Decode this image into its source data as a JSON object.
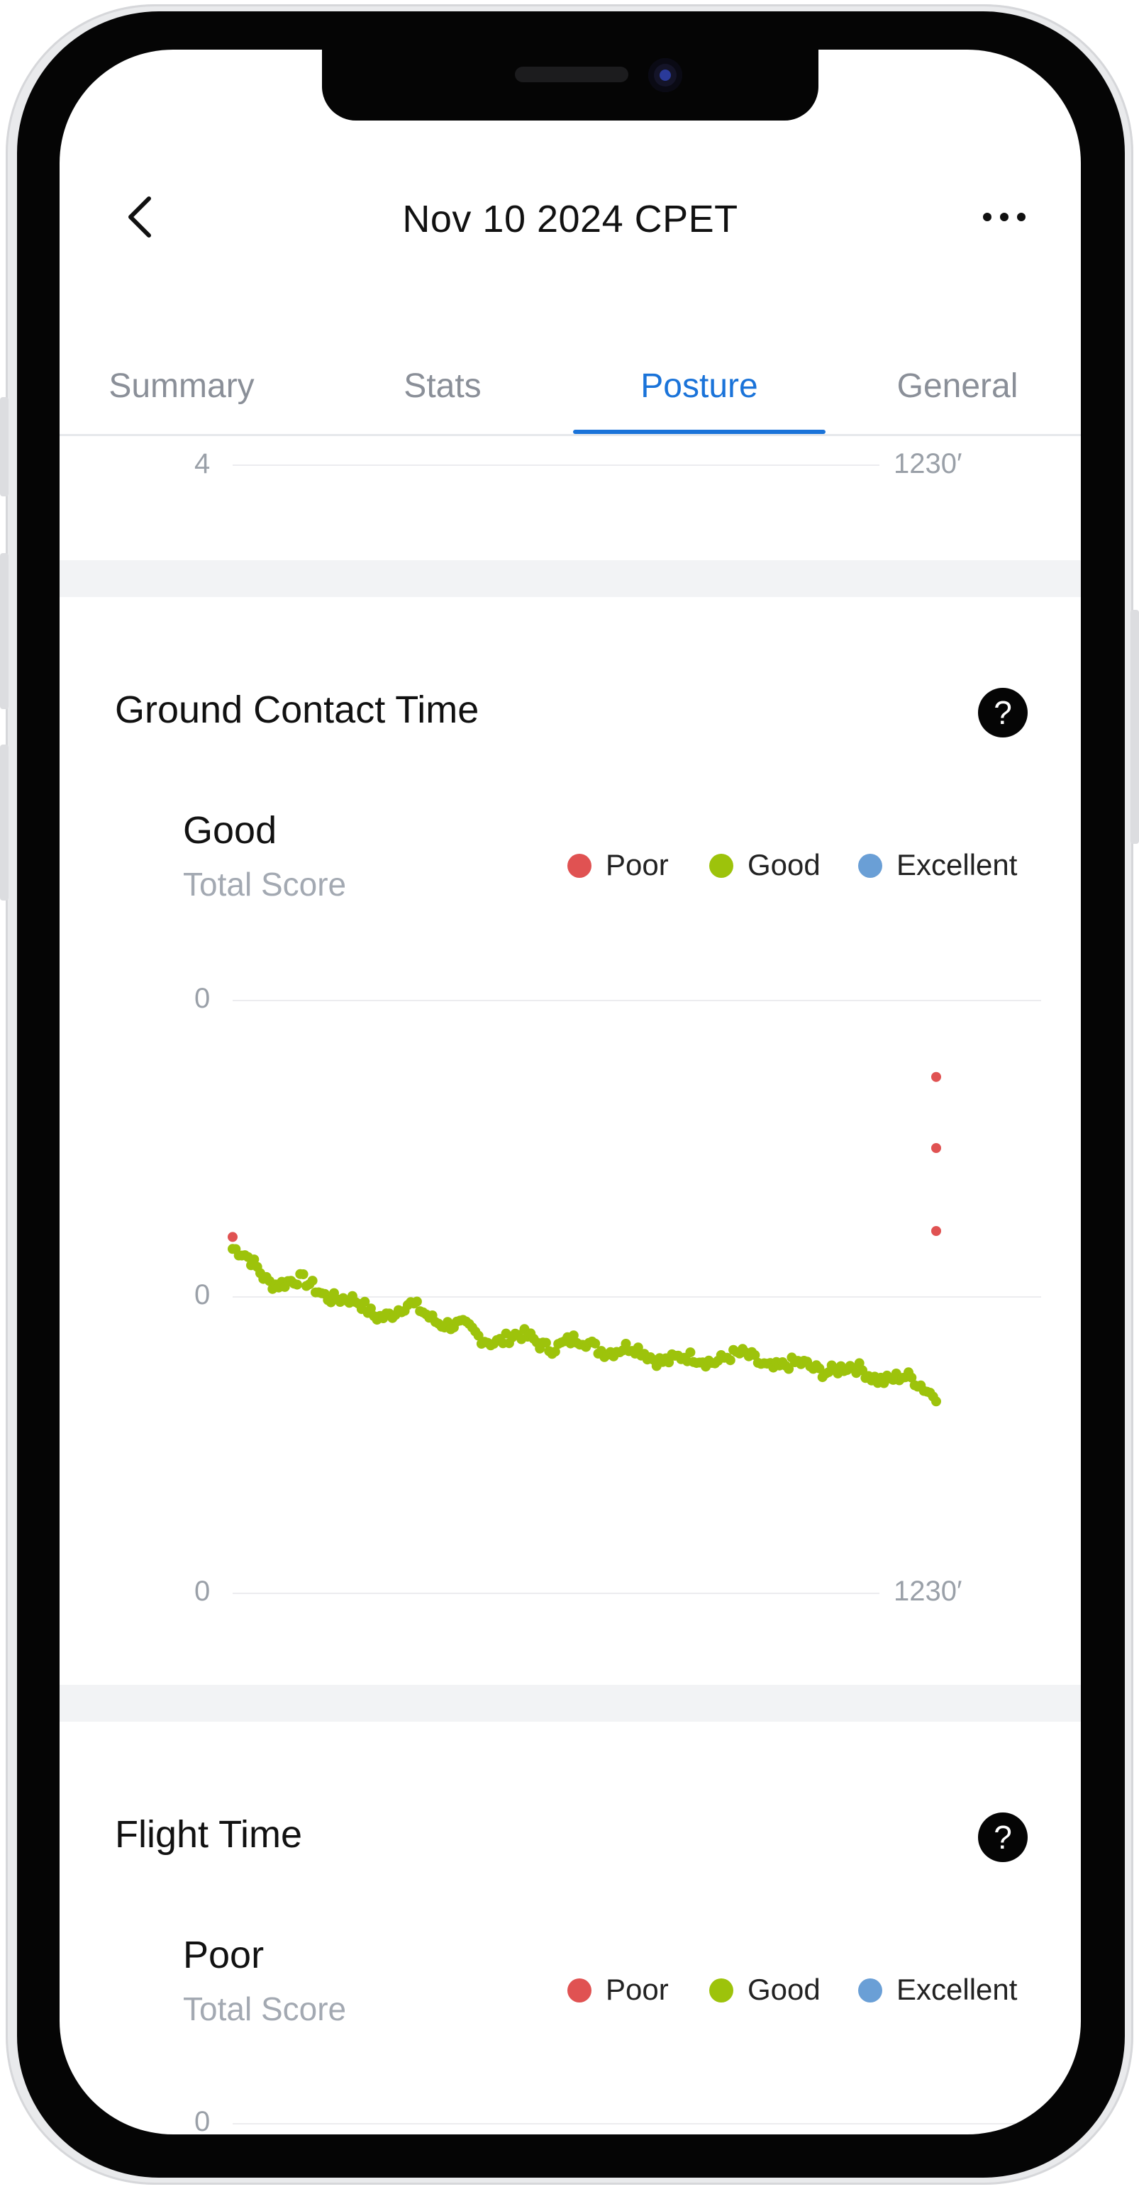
{
  "header": {
    "title": "Nov 10 2024 CPET",
    "back_icon": "chevron-left-icon",
    "more_icon": "more-horizontal-icon"
  },
  "tabs": [
    {
      "label": "Summary",
      "active": false
    },
    {
      "label": "Stats",
      "active": false
    },
    {
      "label": "Posture",
      "active": true
    },
    {
      "label": "General",
      "active": false
    }
  ],
  "colors": {
    "accent": "#1a73d9",
    "poor": "#e05252",
    "good": "#9dc30b",
    "excellent": "#6a9fd6"
  },
  "previous_chart_tail": {
    "y_tick": "4",
    "x_end_label": "1230′"
  },
  "sections": [
    {
      "title": "Ground Contact Time",
      "help_icon": "question-circle-icon",
      "score": "Good",
      "score_caption": "Total Score",
      "legend": [
        "Poor",
        "Good",
        "Excellent"
      ],
      "y_ticks": [
        "0",
        "0",
        "0"
      ],
      "x_end_label": "1230′"
    },
    {
      "title": "Flight Time",
      "help_icon": "question-circle-icon",
      "score": "Poor",
      "score_caption": "Total Score",
      "legend": [
        "Poor",
        "Good",
        "Excellent"
      ],
      "y_ticks": [
        "0"
      ]
    }
  ],
  "chart_data": {
    "type": "scatter",
    "title": "Ground Contact Time",
    "xlabel": "",
    "ylabel": "",
    "x_range_labels": [
      "",
      "1230′"
    ],
    "y_tick_labels": [
      "0",
      "0",
      "0"
    ],
    "series": [
      {
        "name": "Good",
        "color": "#9dc30b",
        "trend": [
          [
            0.0,
            0.58
          ],
          [
            0.05,
            0.53
          ],
          [
            0.1,
            0.52
          ],
          [
            0.15,
            0.5
          ],
          [
            0.2,
            0.47
          ],
          [
            0.25,
            0.48
          ],
          [
            0.3,
            0.46
          ],
          [
            0.35,
            0.43
          ],
          [
            0.4,
            0.43
          ],
          [
            0.45,
            0.42
          ],
          [
            0.5,
            0.42
          ],
          [
            0.55,
            0.41
          ],
          [
            0.6,
            0.4
          ],
          [
            0.65,
            0.39
          ],
          [
            0.7,
            0.4
          ],
          [
            0.75,
            0.39
          ],
          [
            0.8,
            0.38
          ],
          [
            0.85,
            0.38
          ],
          [
            0.9,
            0.37
          ],
          [
            0.95,
            0.36
          ],
          [
            1.0,
            0.34
          ]
        ]
      },
      {
        "name": "Poor",
        "color": "#e05252",
        "points": [
          [
            0.0,
            0.6
          ],
          [
            1.0,
            0.61
          ],
          [
            1.0,
            0.87
          ],
          [
            1.0,
            0.75
          ]
        ]
      }
    ],
    "legend_placement": "top-right",
    "grid": true
  }
}
